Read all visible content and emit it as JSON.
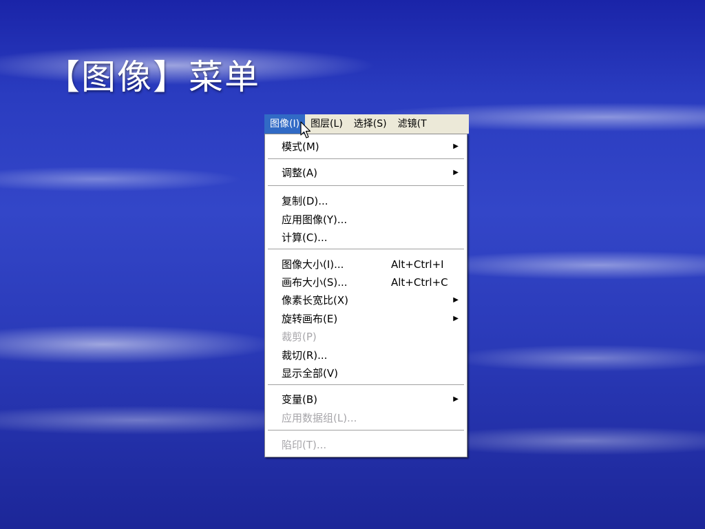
{
  "slide": {
    "title": "【图像】菜单"
  },
  "menubar": {
    "items": [
      {
        "label": "图像(I)"
      },
      {
        "label": "图层(L)"
      },
      {
        "label": "选择(S)"
      },
      {
        "label": "滤镜(T"
      }
    ]
  },
  "menu": {
    "items": [
      {
        "label": "模式(M)",
        "submenu": true
      },
      {
        "label": "调整(A)",
        "submenu": true
      },
      {
        "label": "复制(D)..."
      },
      {
        "label": "应用图像(Y)..."
      },
      {
        "label": "计算(C)..."
      },
      {
        "label": "图像大小(I)...",
        "shortcut": "Alt+Ctrl+I"
      },
      {
        "label": "画布大小(S)...",
        "shortcut": "Alt+Ctrl+C"
      },
      {
        "label": "像素长宽比(X)",
        "submenu": true
      },
      {
        "label": "旋转画布(E)",
        "submenu": true
      },
      {
        "label": "裁剪(P)",
        "disabled": true
      },
      {
        "label": "裁切(R)..."
      },
      {
        "label": "显示全部(V)"
      },
      {
        "label": "变量(B)",
        "submenu": true
      },
      {
        "label": "应用数据组(L)...",
        "disabled": true
      },
      {
        "label": "陷印(T)...",
        "disabled": true
      }
    ],
    "arrow_glyph": "▶"
  },
  "colors": {
    "highlight": "#316ac5",
    "menubar_bg": "#ece9d8",
    "disabled_text": "#a7a6aa"
  }
}
